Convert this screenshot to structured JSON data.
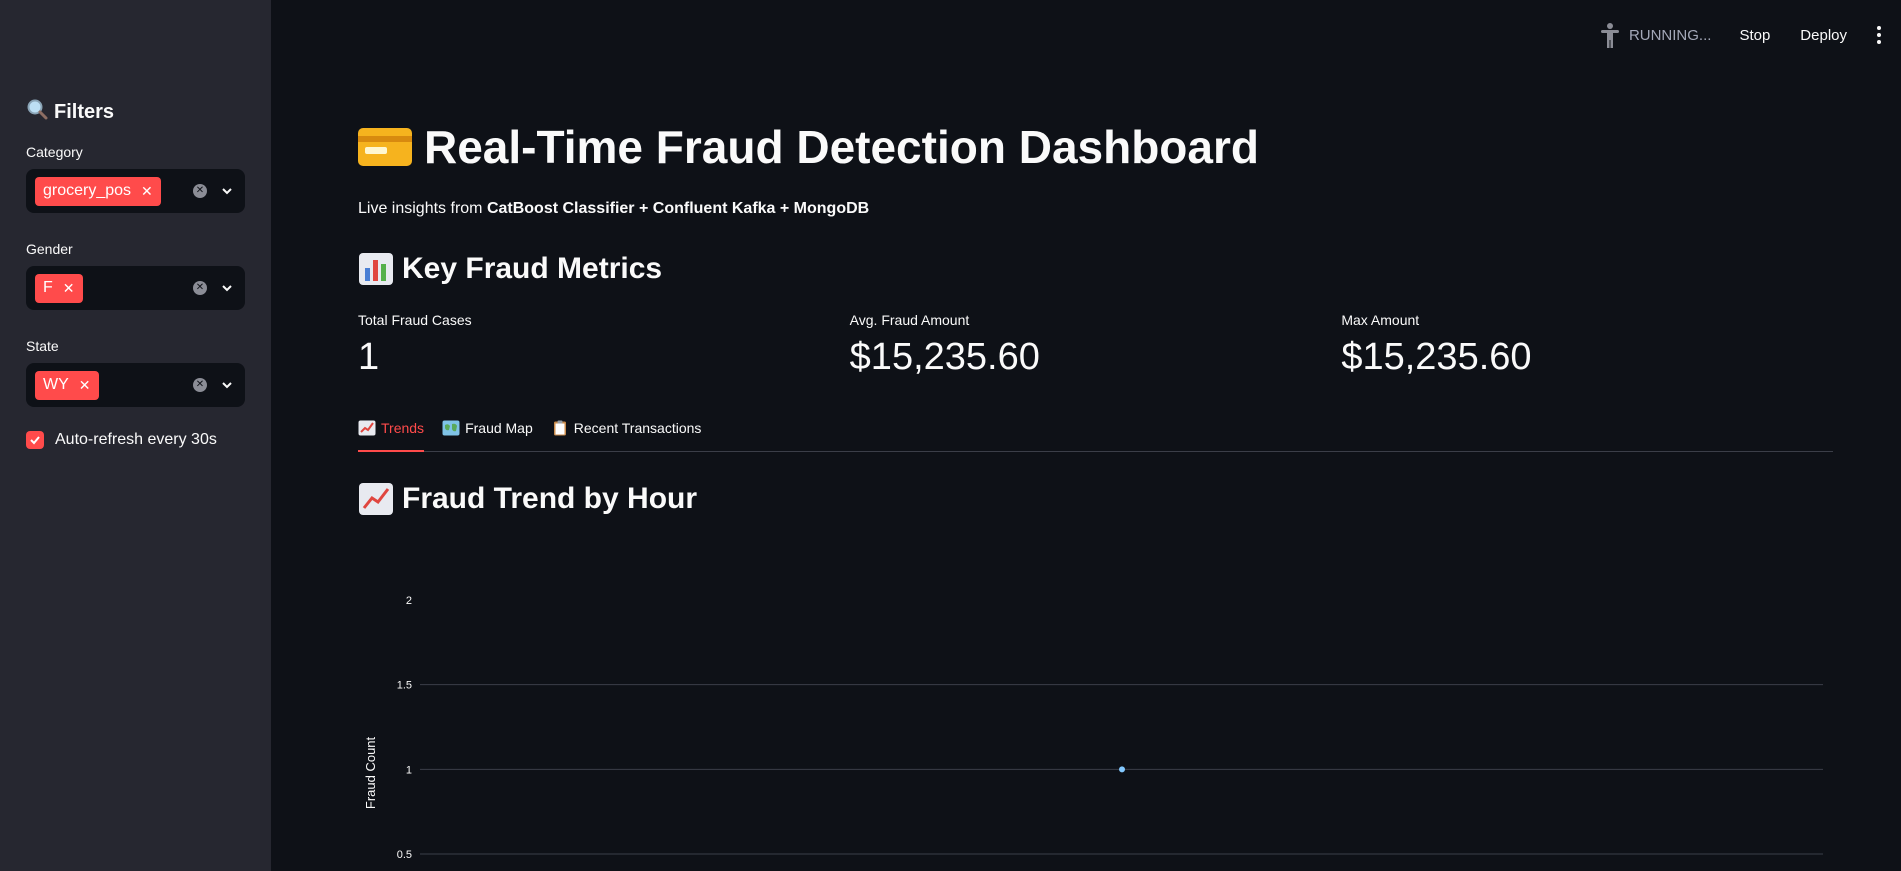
{
  "sidebar": {
    "title": "Filters",
    "filters": [
      {
        "label": "Category",
        "value": "grocery_pos"
      },
      {
        "label": "Gender",
        "value": "F"
      },
      {
        "label": "State",
        "value": "WY"
      }
    ],
    "autorefresh_label": "Auto-refresh every 30s",
    "autorefresh_checked": true
  },
  "topbar": {
    "status": "RUNNING...",
    "stop": "Stop",
    "deploy": "Deploy"
  },
  "main": {
    "title": "Real-Time Fraud Detection Dashboard",
    "subtitle_prefix": "Live insights from ",
    "subtitle_bold": "CatBoost Classifier + Confluent Kafka + MongoDB",
    "metrics_heading": "Key Fraud Metrics",
    "metrics": [
      {
        "label": "Total Fraud Cases",
        "value": "1"
      },
      {
        "label": "Avg. Fraud Amount",
        "value": "$15,235.60"
      },
      {
        "label": "Max Amount",
        "value": "$15,235.60"
      }
    ],
    "tabs": [
      {
        "label": "Trends",
        "active": true
      },
      {
        "label": "Fraud Map",
        "active": false
      },
      {
        "label": "Recent Transactions",
        "active": false
      }
    ],
    "trend_heading": "Fraud Trend by Hour"
  },
  "colors": {
    "accent": "#ff4b4b",
    "background": "#0e1117",
    "sidebar": "#262730",
    "point": "#83c9ff"
  },
  "chart_data": {
    "type": "line",
    "ylabel": "Fraud Count",
    "yticks": [
      "2",
      "1.5",
      "1",
      "0.5"
    ],
    "ylim": [
      0.5,
      2
    ],
    "points": [
      {
        "y": 1
      }
    ],
    "grid": true
  }
}
